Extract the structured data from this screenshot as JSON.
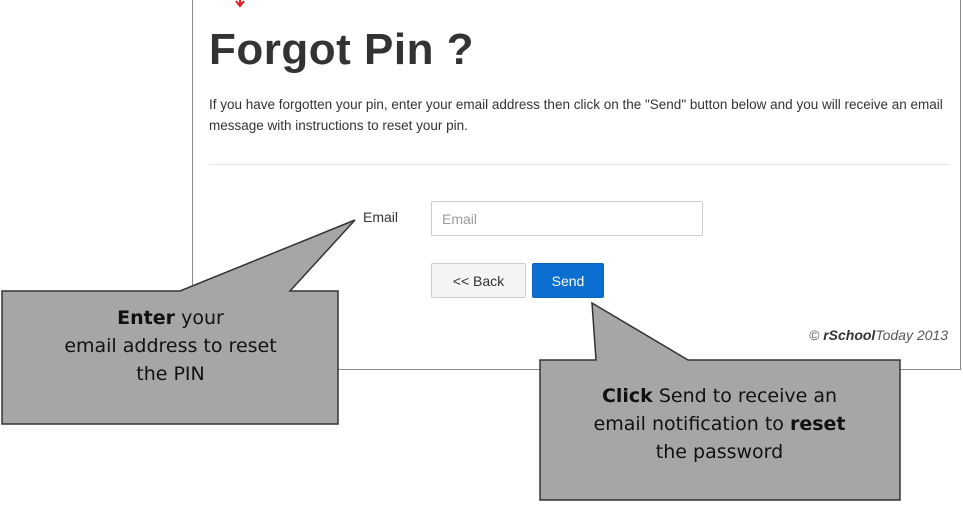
{
  "page": {
    "title": "Forgot Pin ?",
    "description": "If you have forgotten your pin, enter your email address then click on the \"Send\" button below and you will receive an email message with instructions to reset your pin."
  },
  "form": {
    "email_label": "Email",
    "email_placeholder": "Email",
    "email_value": "",
    "back_label": "<< Back",
    "send_label": "Send"
  },
  "footer": {
    "copyright": "©",
    "brand_bold": "rSchool",
    "brand_rest": "Today 2013"
  },
  "callouts": {
    "left": {
      "bold": "Enter",
      "text_1": "your",
      "text_2": "email address to reset",
      "text_3": "the PIN"
    },
    "right": {
      "bold_1": "Click",
      "text_1": "Send to receive an",
      "text_2": "email notification to",
      "bold_2": "reset",
      "text_3": "the password"
    }
  },
  "colors": {
    "send_button": "#0a6fd1",
    "callout_fill": "#a6a6a6",
    "pointer_marker": "#e02020"
  },
  "icons": {
    "pointer": "red-arrow-marker-icon"
  }
}
